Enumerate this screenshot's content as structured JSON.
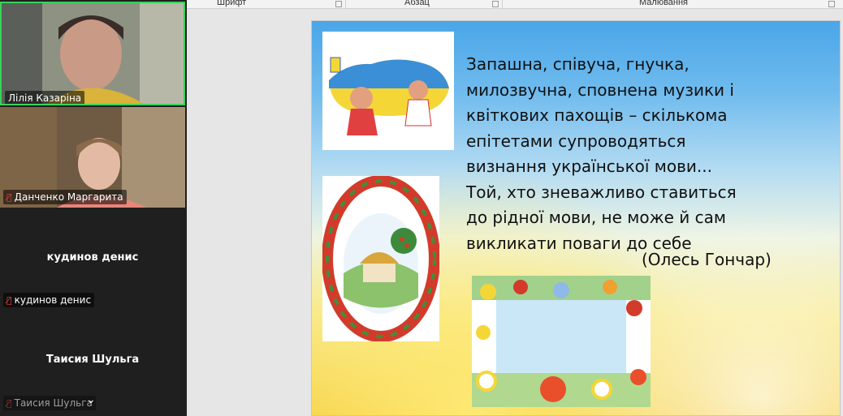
{
  "participants": [
    {
      "name": "Лілія Казаріна",
      "muted": false
    },
    {
      "name": "Данченко Маргарита",
      "muted": true
    },
    {
      "name": "кудинов денис",
      "muted": true
    },
    {
      "name": "Таисия Шульга",
      "muted": true
    }
  ],
  "ribbon": {
    "font_group": "Шрифт",
    "paragraph_group": "Абзац",
    "drawing_group": "Малювання"
  },
  "slide": {
    "quote_lines": [
      "Запашна, співуча, гнучка,",
      "милозвучна, сповнена музики і",
      "квіткових пахощів – скількома",
      "епітетами супроводяться",
      "визнання української мови...",
      "Той, хто зневажливо ставиться",
      "до рідної мови, не може й сам",
      "викликати поваги до себе"
    ],
    "author": "(Олесь Гончар)"
  },
  "colors": {
    "active_speaker": "#39d25a",
    "mic_muted": "#e0423b",
    "panel_bg": "#1f1f1f"
  }
}
